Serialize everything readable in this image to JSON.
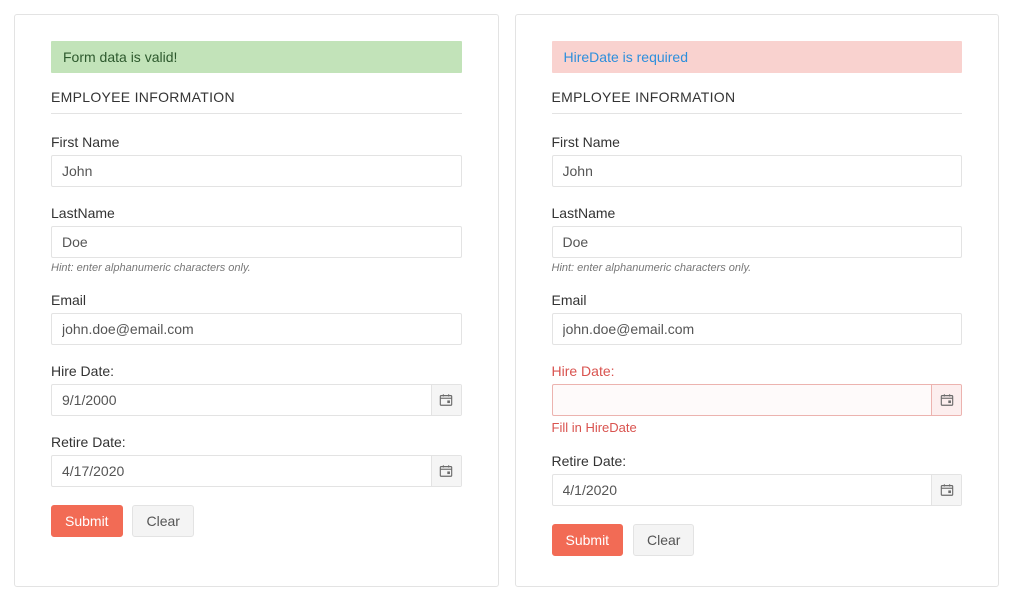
{
  "left": {
    "message": "Form data is valid!",
    "section_title": "EMPLOYEE INFORMATION",
    "first_name": {
      "label": "First Name",
      "value": "John"
    },
    "last_name": {
      "label": "LastName",
      "value": "Doe",
      "hint": "Hint: enter alphanumeric characters only."
    },
    "email": {
      "label": "Email",
      "value": "john.doe@email.com"
    },
    "hire_date": {
      "label": "Hire Date:",
      "value": "9/1/2000"
    },
    "retire_date": {
      "label": "Retire Date:",
      "value": "4/17/2020"
    },
    "submit_label": "Submit",
    "clear_label": "Clear"
  },
  "right": {
    "message": "HireDate is required",
    "section_title": "EMPLOYEE INFORMATION",
    "first_name": {
      "label": "First Name",
      "value": "John"
    },
    "last_name": {
      "label": "LastName",
      "value": "Doe",
      "hint": "Hint: enter alphanumeric characters only."
    },
    "email": {
      "label": "Email",
      "value": "john.doe@email.com"
    },
    "hire_date": {
      "label": "Hire Date:",
      "value": "",
      "error": "Fill in HireDate"
    },
    "retire_date": {
      "label": "Retire Date:",
      "value": "4/1/2020"
    },
    "submit_label": "Submit",
    "clear_label": "Clear"
  }
}
